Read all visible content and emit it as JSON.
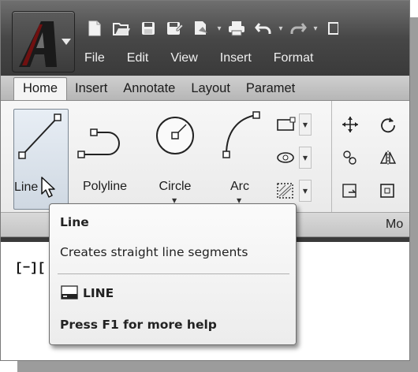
{
  "menubar": {
    "items": [
      "File",
      "Edit",
      "View",
      "Insert",
      "Format"
    ]
  },
  "ribbon": {
    "tabs": [
      "Home",
      "Insert",
      "Annotate",
      "Layout",
      "Paramet"
    ],
    "active_tab": "Home",
    "draw_tools": [
      {
        "label": "Line",
        "icon": "line-icon"
      },
      {
        "label": "Polyline",
        "icon": "polyline-icon"
      },
      {
        "label": "Circle",
        "icon": "circle-icon"
      },
      {
        "label": "Arc",
        "icon": "arc-icon"
      }
    ],
    "panel_titles": {
      "modify": "Mo"
    }
  },
  "drawing": {
    "viewport_label": "[−][",
    "background": "#ffffff"
  },
  "tooltip": {
    "title": "Line",
    "description": "Creates straight line segments",
    "command": "LINE",
    "help": "Press F1 for more help"
  },
  "colors": {
    "title_bar": "#474747",
    "ribbon": "#f0f0f0",
    "selected_tool": "#d4dde7"
  }
}
